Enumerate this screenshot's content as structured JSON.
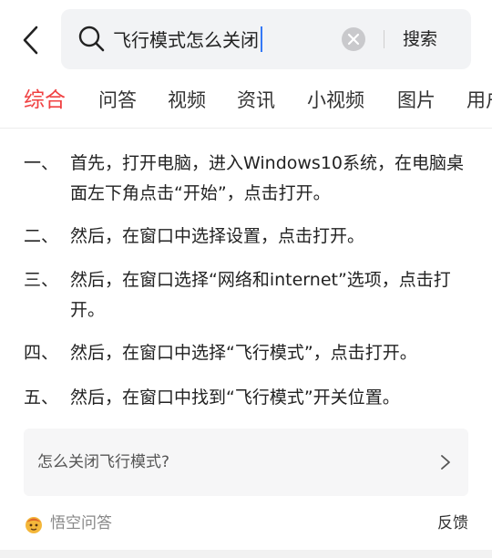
{
  "search": {
    "query": "飞行模式怎么关闭",
    "button_label": "搜索"
  },
  "tabs": [
    {
      "label": "综合",
      "active": true
    },
    {
      "label": "问答",
      "active": false
    },
    {
      "label": "视频",
      "active": false
    },
    {
      "label": "资讯",
      "active": false
    },
    {
      "label": "小视频",
      "active": false
    },
    {
      "label": "图片",
      "active": false
    },
    {
      "label": "用户",
      "active": false
    }
  ],
  "steps": [
    {
      "num": "一、",
      "text": "首先，打开电脑，进入Windows10系统，在电脑桌面左下角点击“开始”，点击打开。"
    },
    {
      "num": "二、",
      "text": "然后，在窗口中选择设置，点击打开。"
    },
    {
      "num": "三、",
      "text": "然后，在窗口选择“网络和internet”选项，点击打开。"
    },
    {
      "num": "四、",
      "text": "然后，在窗口中选择“飞行模式”，点击打开。"
    },
    {
      "num": "五、",
      "text": "然后，在窗口中找到“飞行模式”开关位置。"
    }
  ],
  "related_question": "怎么关闭飞行模式?",
  "footer": {
    "source": "悟空问答",
    "feedback": "反馈"
  },
  "colors": {
    "accent": "#f04142",
    "caret": "#3478f6",
    "search_bg": "#f2f3f5"
  },
  "icons": {
    "back": "back-arrow-icon",
    "search": "search-icon",
    "clear": "clear-icon",
    "related_arrow": "chevron-right-icon",
    "avatar": "wukong-avatar-icon"
  }
}
